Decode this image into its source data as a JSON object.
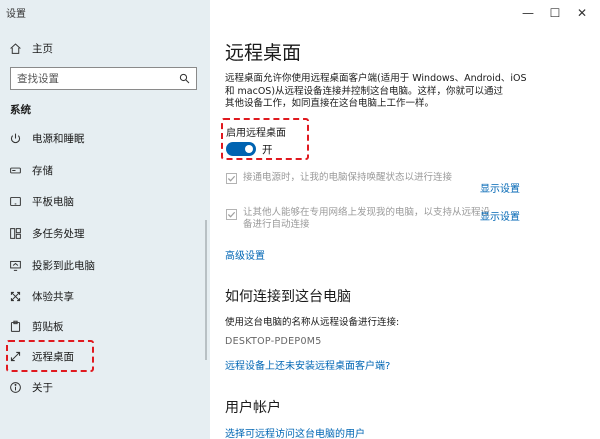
{
  "window": {
    "app_title": "设置",
    "minimize_glyph": "—",
    "maximize_glyph": "☐",
    "close_glyph": "✕"
  },
  "sidebar": {
    "home_label": "主页",
    "search_placeholder": "查找设置",
    "section_label": "系统",
    "items": [
      {
        "label": "电源和睡眠",
        "icon": "power-icon"
      },
      {
        "label": "存储",
        "icon": "storage-icon"
      },
      {
        "label": "平板电脑",
        "icon": "tablet-icon"
      },
      {
        "label": "多任务处理",
        "icon": "multitasking-icon"
      },
      {
        "label": "投影到此电脑",
        "icon": "projection-icon"
      },
      {
        "label": "体验共享",
        "icon": "share-icon"
      },
      {
        "label": "剪贴板",
        "icon": "clipboard-icon"
      },
      {
        "label": "远程桌面",
        "icon": "remote-desktop-icon"
      },
      {
        "label": "关于",
        "icon": "info-icon"
      }
    ]
  },
  "main": {
    "title": "远程桌面",
    "description_line1": "远程桌面允许你使用远程桌面客户端(适用于 Windows、Android、iOS",
    "description_line2": "和 macOS)从远程设备连接并控制这台电脑。这样，你就可以通过",
    "description_line3": "其他设备工作，如同直接在这台电脑上工作一样。",
    "toggle_caption": "启用远程桌面",
    "toggle_state": "开",
    "toggle_on": true,
    "option1_text": "接通电源时，让我的电脑保持唤醒状态以进行连接",
    "option1_link": "显示设置",
    "option2_line1": "让其他人能够在专用网络上发现我的电脑，以支持从远程设",
    "option2_line2": "备进行自动连接",
    "option2_link": "显示设置",
    "advanced_link": "高级设置",
    "how_to_heading": "如何连接到这台电脑",
    "how_to_text": "使用这台电脑的名称从远程设备进行连接:",
    "pc_name": "DESKTOP-PDEP0M5",
    "no_client_link": "远程设备上还未安装远程桌面客户端?",
    "user_accounts_heading": "用户帐户",
    "select_users_link": "选择可远程访问这台电脑的用户"
  },
  "colors": {
    "accent": "#0063b1",
    "link": "#0066b4",
    "highlight": "#e0191f",
    "sidebar_bg": "#e6eef2"
  }
}
